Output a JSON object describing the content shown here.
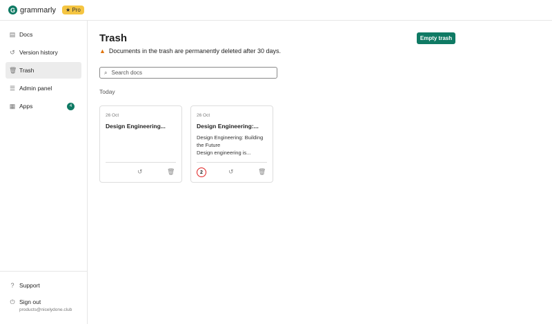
{
  "header": {
    "brand": "grammarly",
    "pro": "★ Pro",
    "logo": "G"
  },
  "sidebar": {
    "items": [
      {
        "label": "Docs",
        "icon": "doc-icon",
        "glyph": "▤"
      },
      {
        "label": "Version history",
        "icon": "history-icon",
        "glyph": "↺"
      },
      {
        "label": "Trash",
        "icon": "trash-icon",
        "glyph": "🗑"
      },
      {
        "label": "Admin panel",
        "icon": "sliders-icon",
        "glyph": "☰"
      },
      {
        "label": "Apps",
        "icon": "apps-icon",
        "glyph": "▦",
        "badge": "4"
      }
    ],
    "support": "Support",
    "signout": "Sign out",
    "email": "products@nicelydone.club"
  },
  "main": {
    "title": "Trash",
    "warning": "Documents in the trash are permanently deleted after 30 days.",
    "empty_button": "Empty trash",
    "search_placeholder": "Search docs",
    "section": "Today",
    "cards": [
      {
        "date": "26 Oct",
        "title": "Design Engineering...",
        "body": ""
      },
      {
        "date": "26 Oct",
        "title": "Design Engineering:...",
        "body": "Design Engineering: Building the Future\nDesign engineering is...",
        "marker": "2"
      }
    ]
  }
}
